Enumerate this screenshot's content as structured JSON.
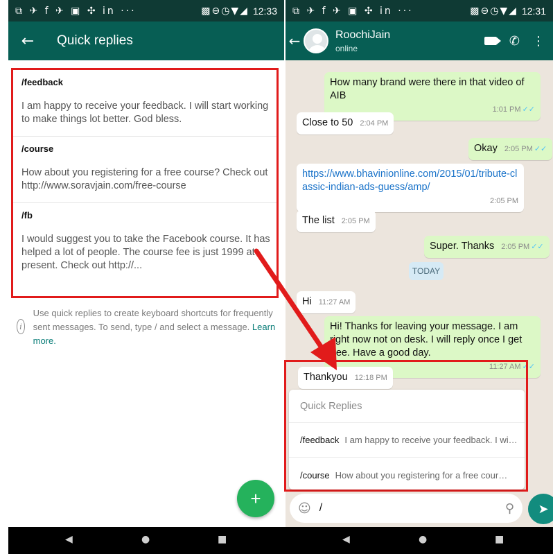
{
  "left": {
    "status": {
      "icons": "⧉ ✈ f ✈ ▣ ✣ in  ···",
      "right_icons": "▩⊖◷▼◢",
      "time": "12:33"
    },
    "appbar": {
      "back_icon": "arrow-left-icon",
      "title": "Quick replies"
    },
    "replies": [
      {
        "shortcut": "/feedback",
        "message": "I am happy to receive your feedback. I will start working to make things lot better. God bless."
      },
      {
        "shortcut": "/course",
        "message": "How about you registering for a free course? Check out http://www.soravjain.com/free-course"
      },
      {
        "shortcut": "/fb",
        "message": "I would suggest you to take the Facebook course. It has helped a lot of people. The course fee is just 1999 at present. Check out http://..."
      }
    ],
    "hint": {
      "text": "Use quick replies to create keyboard shortcuts for frequently sent messages. To send, type / and select a message.",
      "link": "Learn more."
    },
    "fab": {
      "label": "+"
    }
  },
  "right": {
    "status": {
      "icons": "⧉ ✈ f ✈ ▣ ✣ in  ···",
      "right_icons": "▩⊖◷▼◢",
      "time": "12:31"
    },
    "contact": {
      "name": "RoochiJain",
      "status": "online"
    },
    "messages": [
      {
        "dir": "out",
        "text": "How many brand were there in that video of AIB",
        "time": "1:01 PM",
        "ticks": "✓✓"
      },
      {
        "dir": "in",
        "text": "Close to 50",
        "time": "2:04 PM"
      },
      {
        "dir": "out",
        "text": "Okay",
        "time": "2:05 PM",
        "ticks": "✓✓"
      },
      {
        "dir": "in",
        "text": "https://www.bhavinionline.com/2015/01/tribute-classic-indian-ads-guess/amp/",
        "time": "2:05 PM"
      },
      {
        "dir": "in",
        "text": "The list",
        "time": "2:05 PM"
      },
      {
        "dir": "out",
        "text": "Super. Thanks",
        "time": "2:05 PM",
        "ticks": "✓✓"
      },
      {
        "dir": "in",
        "text": "Hi",
        "time": "11:27 AM"
      },
      {
        "dir": "out",
        "text": "Hi! Thanks for leaving your message. I am right now not on desk. I will reply once I get free. Have a good day.",
        "time": "11:27 AM",
        "ticks": "✓✓"
      },
      {
        "dir": "in",
        "text": "Thankyou",
        "time": "12:18 PM"
      }
    ],
    "date_chip": "TODAY",
    "popup": {
      "title": "Quick Replies",
      "rows": [
        {
          "key": "/feedback",
          "preview": "I am happy to receive your feedback. I will start working to make things lot better. God bless."
        },
        {
          "key": "/course",
          "preview": "How about you registering for a free course? Check out http://www.soravjain.com/free-course"
        }
      ]
    },
    "input": {
      "value": "/"
    },
    "send_icon": "send-icon"
  },
  "nav": {
    "back": "◀",
    "home": "●",
    "recents": "■"
  },
  "colors": {
    "toolbar": "#075e54",
    "status": "#0f3a34",
    "chat_bg": "#ece5dd",
    "bubble_out": "#dcf8c6",
    "highlight": "#e11b1b",
    "fab": "#25b25c"
  }
}
